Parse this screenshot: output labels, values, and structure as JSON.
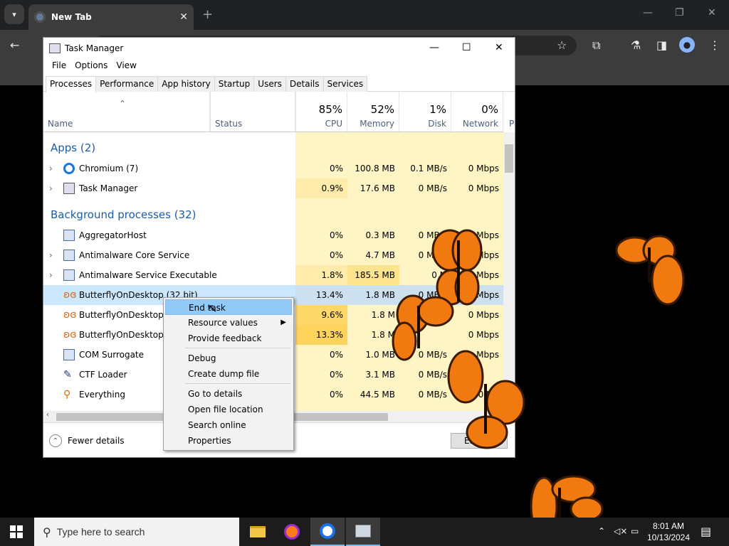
{
  "browser": {
    "tab_title": "New Tab",
    "tab_close": "✕",
    "new_tab": "+",
    "minimize": "—",
    "restore": "❐",
    "close": "✕"
  },
  "task_manager": {
    "title": "Task Manager",
    "menu": [
      "File",
      "Options",
      "View"
    ],
    "tabs": [
      "Processes",
      "Performance",
      "App history",
      "Startup",
      "Users",
      "Details",
      "Services"
    ],
    "columns": {
      "name": "Name",
      "status": "Status",
      "cpu": {
        "pct": "85%",
        "label": "CPU"
      },
      "memory": {
        "pct": "52%",
        "label": "Memory"
      },
      "disk": {
        "pct": "1%",
        "label": "Disk"
      },
      "network": {
        "pct": "0%",
        "label": "Network"
      },
      "power": "P"
    },
    "groups": {
      "apps": "Apps (2)",
      "background": "Background processes (32)"
    },
    "rows": [
      {
        "name": "Chromium (7)",
        "cpu": "0%",
        "mem": "100.8 MB",
        "disk": "0.1 MB/s",
        "net": "0 Mbps"
      },
      {
        "name": "Task Manager",
        "cpu": "0.9%",
        "mem": "17.6 MB",
        "disk": "0 MB/s",
        "net": "0 Mbps"
      },
      {
        "name": "AggregatorHost",
        "cpu": "0%",
        "mem": "0.3 MB",
        "disk": "0 MB/s",
        "net": "Mbps"
      },
      {
        "name": "Antimalware Core Service",
        "cpu": "0%",
        "mem": "4.7 MB",
        "disk": "0 MB/s",
        "net": "Mbps"
      },
      {
        "name": "Antimalware Service Executable",
        "cpu": "1.8%",
        "mem": "185.5 MB",
        "disk": "0 M",
        "net": "Mbps"
      },
      {
        "name": "ButterflyOnDesktop (32 bit)",
        "cpu": "13.4%",
        "mem": "1.8 MB",
        "disk": "0 MB/s",
        "net": "Mbps"
      },
      {
        "name": "ButterflyOnDesktop (3",
        "cpu": "9.6%",
        "mem": "1.8 M",
        "disk": "",
        "net": "0 Mbps"
      },
      {
        "name": "ButterflyOnDesktop (3",
        "cpu": "13.3%",
        "mem": "1.8 M",
        "disk": "",
        "net": "0 Mbps"
      },
      {
        "name": "COM Surrogate",
        "cpu": "0%",
        "mem": "1.0 MB",
        "disk": "0 MB/s",
        "net": "Mbps"
      },
      {
        "name": "CTF Loader",
        "cpu": "0%",
        "mem": "3.1 MB",
        "disk": "0 MB/s",
        "net": ""
      },
      {
        "name": "Everything",
        "cpu": "0%",
        "mem": "44.5 MB",
        "disk": "0 MB/s",
        "net": "0 Mb"
      }
    ],
    "fewer_details": "Fewer details",
    "end_task_button": "End task"
  },
  "context_menu": {
    "items": [
      "End task",
      "Resource values",
      "Provide feedback",
      "Debug",
      "Create dump file",
      "Go to details",
      "Open file location",
      "Search online",
      "Properties"
    ]
  },
  "taskbar": {
    "search_placeholder": "Type here to search",
    "time": "8:01 AM",
    "date": "10/13/2024"
  }
}
